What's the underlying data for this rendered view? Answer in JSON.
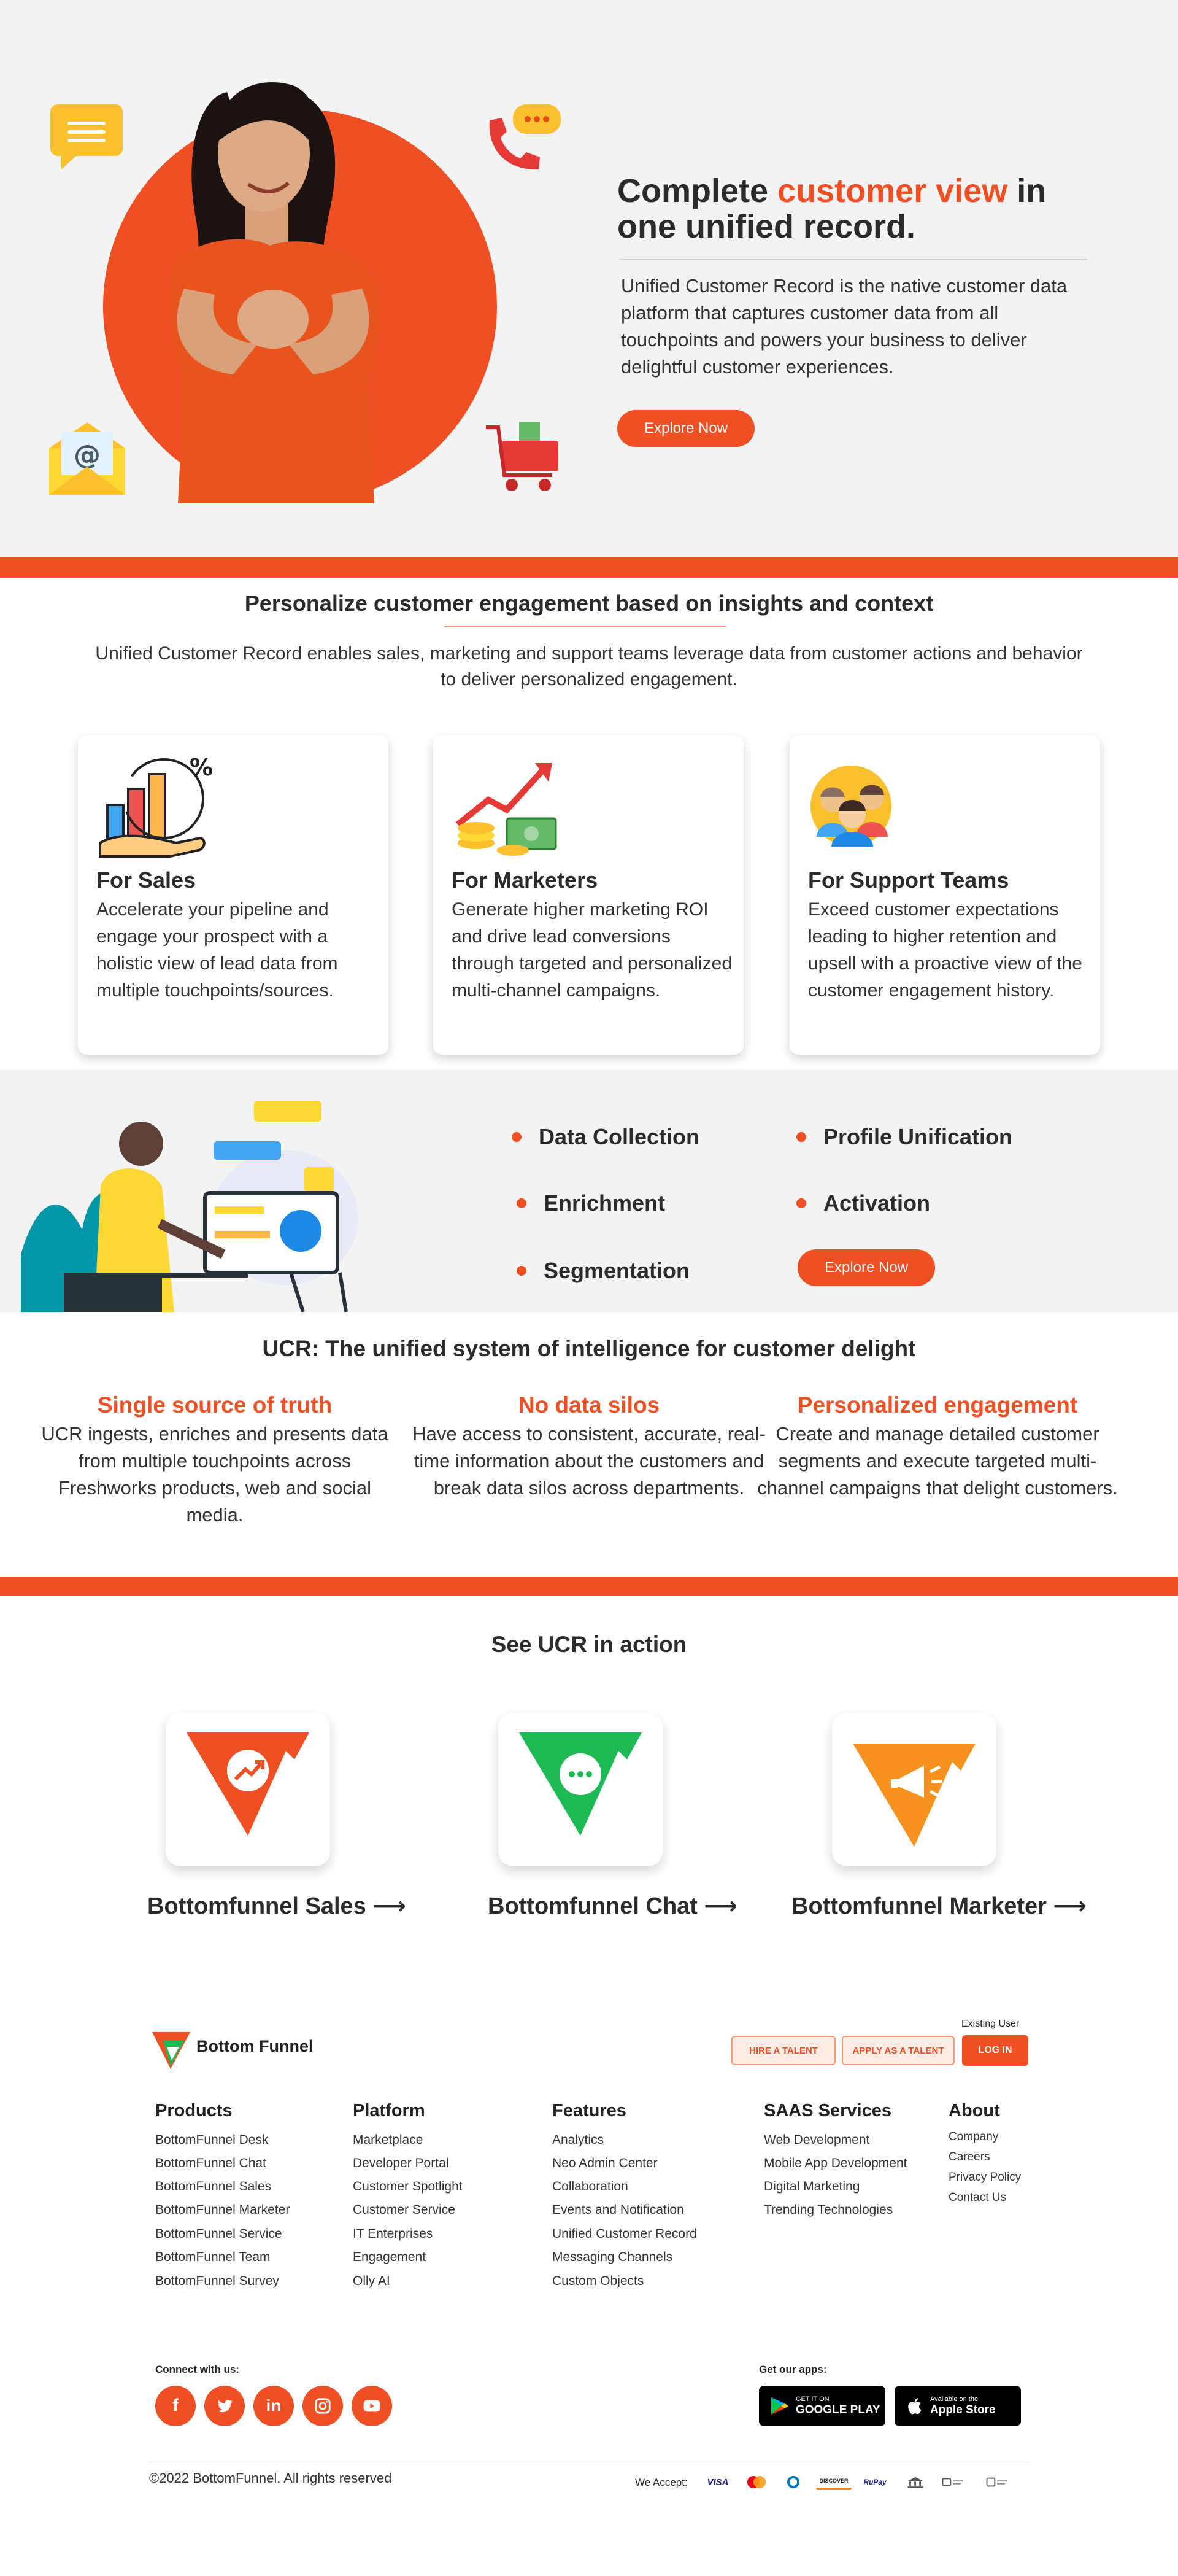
{
  "hero": {
    "title_prefix": "Complete ",
    "title_accent": "customer view",
    "title_suffix": " in one unified record.",
    "description": "Unified Customer Record is the native customer data platform that captures customer data from all touchpoints and powers your business to deliver delightful customer experiences.",
    "cta": "Explore Now",
    "accent_color": "#f04e23"
  },
  "personalize": {
    "title": "Personalize customer engagement based on insights and context",
    "description": "Unified Customer Record enables sales, marketing and support teams leverage data from customer actions and behavior to deliver personalized engagement.",
    "cards": [
      {
        "title": "For Sales",
        "description": "Accelerate your pipeline and engage your prospect with a holistic view of lead data from multiple touchpoints/sources.",
        "icon": "sales-chart-hand-icon"
      },
      {
        "title": "For Marketers",
        "description": "Generate higher marketing ROI and drive lead conversions through targeted and personalized multi-channel campaigns.",
        "icon": "coins-growth-icon"
      },
      {
        "title": "For Support Teams",
        "description": "Exceed customer expectations leading to higher retention and upsell with a proactive view of the customer engagement history.",
        "icon": "support-team-icon"
      }
    ]
  },
  "features": {
    "items": [
      "Data Collection",
      "Profile Unification",
      "Enrichment",
      "Activation",
      "Segmentation"
    ],
    "cta": "Explore Now"
  },
  "ucr": {
    "title": "UCR: The unified system of intelligence for customer delight",
    "columns": [
      {
        "title": "Single source of truth",
        "description": "UCR ingests, enriches and presents data from multiple touchpoints across Freshworks products, web and social media."
      },
      {
        "title": "No data silos",
        "description": "Have access to consistent, accurate, real-time information about the customers and break data silos across departments."
      },
      {
        "title": "Personalized engagement",
        "description": "Create and manage detailed customer segments and execute targeted multi-channel campaigns that delight customers."
      }
    ]
  },
  "action": {
    "title": "See UCR in action",
    "products": [
      {
        "label": "Bottomfunnel Sales",
        "arrow": "⟶",
        "color": "#f04e23",
        "icon": "sales-growth-icon"
      },
      {
        "label": "Bottomfunnel Chat",
        "arrow": "⟶",
        "color": "#1db954",
        "icon": "chat-bubble-icon"
      },
      {
        "label": "Bottomfunnel Marketer",
        "arrow": "⟶",
        "color": "#f7921e",
        "icon": "megaphone-icon"
      }
    ]
  },
  "footer": {
    "brand": "Bottom Funnel",
    "hire_talent": "HIRE A TALENT",
    "apply_talent": "APPLY AS A TALENT",
    "existing_user": "Existing User",
    "login": "LOG IN",
    "columns": [
      {
        "heading": "Products",
        "links": [
          "BottomFunnel Desk",
          "BottomFunnel Chat",
          "BottomFunnel Sales",
          "BottomFunnel Marketer",
          "BottomFunnel Service",
          "BottomFunnel Team",
          "BottomFunnel Survey"
        ]
      },
      {
        "heading": "Platform",
        "links": [
          "Marketplace",
          "Developer Portal",
          "Customer Spotlight",
          "Customer Service",
          "IT Enterprises",
          "Engagement",
          "Olly AI"
        ]
      },
      {
        "heading": "Features",
        "links": [
          "Analytics",
          "Neo Admin Center",
          "Collaboration",
          "Events and Notification",
          "Unified Customer Record",
          "Messaging Channels",
          "Custom Objects"
        ]
      },
      {
        "heading": "SAAS Services",
        "links": [
          "Web Development",
          "Mobile App Development",
          "Digital Marketing",
          "Trending Technologies"
        ]
      },
      {
        "heading": "About",
        "links": [
          "Company",
          "Careers",
          "Privacy Policy",
          "Contact Us"
        ]
      }
    ],
    "connect_label": "Connect with us:",
    "social": [
      "facebook-icon",
      "twitter-icon",
      "linkedin-icon",
      "instagram-icon",
      "youtube-icon"
    ],
    "apps_label": "Get our apps:",
    "google_play": {
      "small": "GET IT ON",
      "big": "GOOGLE PLAY"
    },
    "apple_store": {
      "small": "Available on the",
      "big": "Apple Store"
    },
    "copyright": "©2022 BottomFunnel. All rights reserved",
    "we_accept": "We Accept:",
    "payments": [
      "VISA",
      "DISCOVER",
      "RuPay"
    ]
  }
}
